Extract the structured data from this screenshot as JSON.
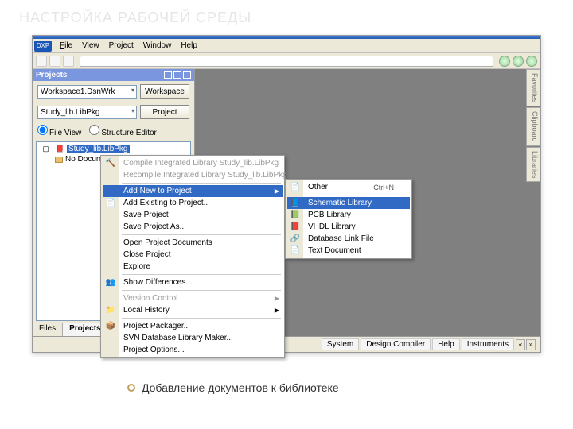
{
  "slide": {
    "title": "НАСТРОЙКА РАБОЧЕЙ СРЕДЫ",
    "caption": "Добавление документов к библиотеке"
  },
  "app": {
    "logo": "DXP",
    "menubar": [
      "File",
      "View",
      "Project",
      "Window",
      "Help"
    ],
    "panel": {
      "title": "Projects",
      "workspace": "Workspace1.DsnWrk",
      "workspace_btn": "Workspace",
      "project": "Study_lib.LibPkg",
      "project_btn": "Project",
      "radio_file": "File View",
      "radio_struct": "Structure Editor",
      "tree_root": "Study_lib.LibPkg",
      "tree_nodocs": "No Documents",
      "tab_files": "Files",
      "tab_projects": "Projects"
    },
    "side_tabs": [
      "Favorites",
      "Clipboard",
      "Libraries"
    ],
    "statusbar": [
      "System",
      "Design Compiler",
      "Help",
      "Instruments"
    ]
  },
  "context_menu": {
    "compile": "Compile Integrated Library Study_lib.LibPkg",
    "recompile": "Recompile Integrated Library Study_lib.LibPkg",
    "add_new": "Add New to Project",
    "add_existing": "Add Existing to Project...",
    "save": "Save Project",
    "save_as": "Save Project As...",
    "open_docs": "Open Project Documents",
    "close": "Close Project",
    "explore": "Explore",
    "show_diff": "Show Differences...",
    "version": "Version Control",
    "history": "Local History",
    "packager": "Project Packager...",
    "svn": "SVN Database Library Maker...",
    "options": "Project Options..."
  },
  "submenu": {
    "other": "Other",
    "other_sc": "Ctrl+N",
    "schematic": "Schematic Library",
    "pcb": "PCB Library",
    "vhdl": "VHDL Library",
    "dblink": "Database Link File",
    "textdoc": "Text Document"
  }
}
